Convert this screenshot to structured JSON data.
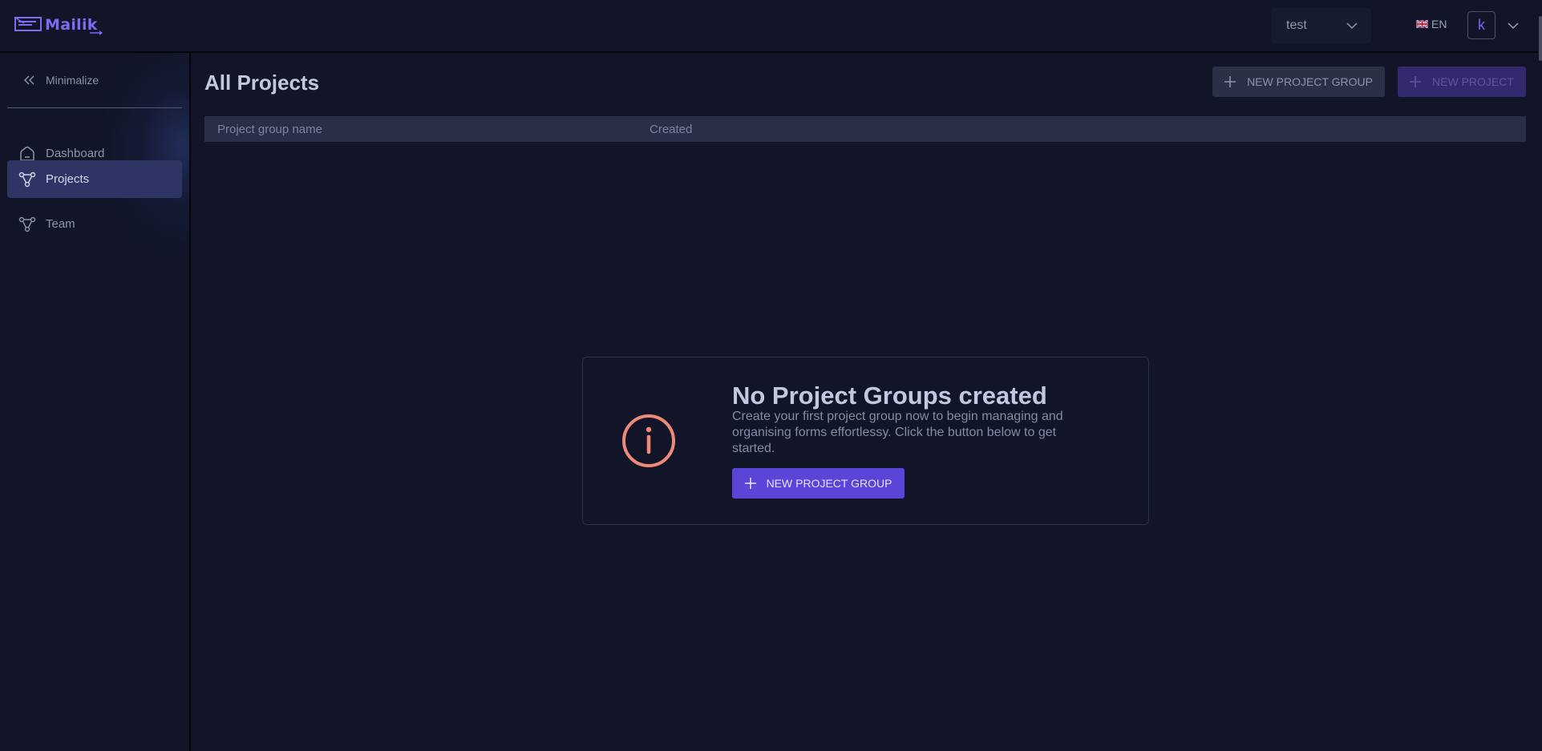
{
  "brand": {
    "name": "Mailik",
    "color": "#7b6cf2"
  },
  "header": {
    "workspace": {
      "selected": "test"
    },
    "language": {
      "code": "EN",
      "flag": "uk-flag"
    },
    "user": {
      "initial": "k"
    }
  },
  "sidebar": {
    "minimize_label": "Minimalize",
    "items": [
      {
        "label": "Dashboard",
        "icon": "home-icon",
        "active": false
      },
      {
        "label": "Projects",
        "icon": "network-icon",
        "active": true
      },
      {
        "label": "Team",
        "icon": "network-icon",
        "active": false
      }
    ]
  },
  "main": {
    "title": "All Projects",
    "actions": {
      "new_group_label": "NEW PROJECT GROUP",
      "new_project_label": "NEW PROJECT"
    },
    "table": {
      "columns": [
        "Project group name",
        "Created"
      ]
    },
    "empty_state": {
      "icon": "info-icon",
      "title": "No Project Groups created",
      "description": "Create your first project group now to begin managing and organising forms effortlessy. Click the button below to get started.",
      "button_label": "NEW PROJECT GROUP"
    }
  },
  "colors": {
    "background": "#121527",
    "accent": "#5b45d8",
    "active_nav": "#2e3564",
    "info_icon": "#ef8a78"
  }
}
